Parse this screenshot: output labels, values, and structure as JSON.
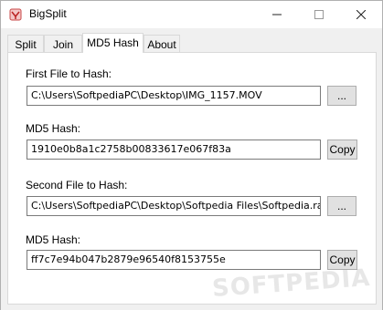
{
  "window": {
    "title": "BigSplit",
    "minimize": "—",
    "maximize": "☐",
    "close": "✕"
  },
  "tabs": [
    {
      "label": "Split",
      "selected": false
    },
    {
      "label": "Join",
      "selected": false
    },
    {
      "label": "MD5 Hash",
      "selected": true
    },
    {
      "label": "About",
      "selected": false
    }
  ],
  "md5": {
    "first_label": "First File to Hash:",
    "first_path": "C:\\Users\\SoftpediaPC\\Desktop\\IMG_1157.MOV",
    "browse_label": "...",
    "hash1_label": "MD5 Hash:",
    "hash1_value": "1910e0b8a1c2758b00833617e067f83a",
    "copy_label": "Copy",
    "second_label": "Second File to Hash:",
    "second_path": "C:\\Users\\SoftpediaPC\\Desktop\\Softpedia Files\\Softpedia.rar",
    "hash2_label": "MD5 Hash:",
    "hash2_value": "ff7c7e94b047b2879e96540f8153755e"
  },
  "watermark": "SOFTPEDIA"
}
